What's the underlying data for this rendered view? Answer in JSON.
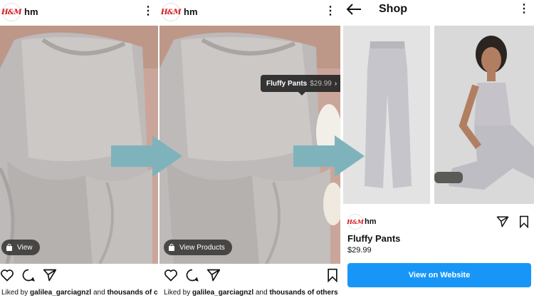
{
  "post_left": {
    "username": "hm",
    "logo_text": "H&M",
    "view_pill": "View",
    "likes_prefix": "Liked by ",
    "likes_user": "galilea_garciagnzl",
    "likes_suffix": " and ",
    "likes_rest": "thousands of c"
  },
  "post_right": {
    "username": "hm",
    "logo_text": "H&M",
    "tag_name": "Fluffy Pants",
    "tag_price": "$29.99",
    "tag_chevron": "›",
    "view_products_pill": "View Products",
    "likes_prefix": "Liked by ",
    "likes_user": "galilea_garciagnzl",
    "likes_suffix": " and ",
    "likes_rest": "thousands of others"
  },
  "shop": {
    "title": "Shop",
    "username": "hm",
    "logo_text": "H&M",
    "product_name": "Fluffy Pants",
    "product_price": "$29.99",
    "cta": "View on Website"
  },
  "icons": [
    "kebab-menu-icon",
    "heart-icon",
    "comment-icon",
    "send-icon",
    "bookmark-icon",
    "back-arrow-icon",
    "shopping-bag-icon"
  ],
  "colors": {
    "accent": "#1796f8",
    "brand": "#d3141c",
    "arrow": "#7fb3bc"
  }
}
